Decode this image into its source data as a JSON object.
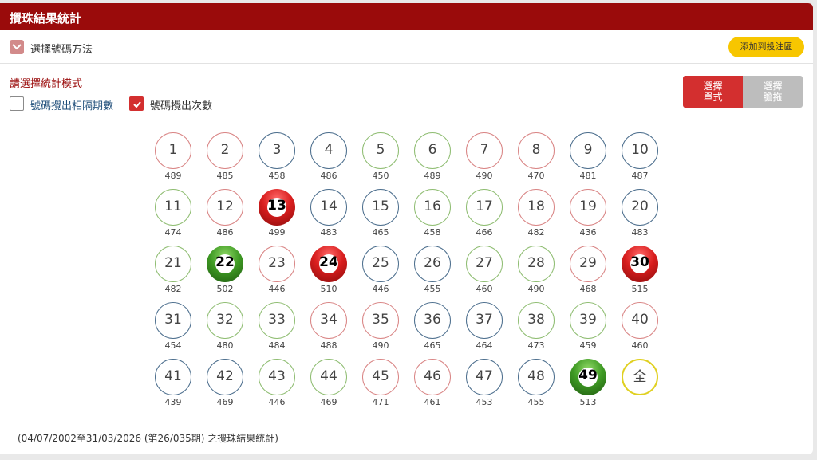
{
  "header": {
    "title": "攪珠結果統計"
  },
  "method": {
    "label": "選擇號碼方法",
    "add_button": "添加到投注區"
  },
  "mode": {
    "title": "請選擇統計模式",
    "option_interval": "號碼攪出相隔期數",
    "option_count": "號碼攪出次數",
    "option_interval_checked": false,
    "option_count_checked": true
  },
  "select": {
    "single_line1": "選擇",
    "single_line2": "單式",
    "banker_line1": "選擇",
    "banker_line2": "膽拖"
  },
  "balls": [
    {
      "n": "1",
      "c": "489",
      "color": "red"
    },
    {
      "n": "2",
      "c": "485",
      "color": "red"
    },
    {
      "n": "3",
      "c": "458",
      "color": "blue"
    },
    {
      "n": "4",
      "c": "486",
      "color": "blue"
    },
    {
      "n": "5",
      "c": "450",
      "color": "green"
    },
    {
      "n": "6",
      "c": "489",
      "color": "green"
    },
    {
      "n": "7",
      "c": "490",
      "color": "red"
    },
    {
      "n": "8",
      "c": "470",
      "color": "red"
    },
    {
      "n": "9",
      "c": "481",
      "color": "blue"
    },
    {
      "n": "10",
      "c": "487",
      "color": "blue"
    },
    {
      "n": "11",
      "c": "474",
      "color": "green"
    },
    {
      "n": "12",
      "c": "486",
      "color": "red"
    },
    {
      "n": "13",
      "c": "499",
      "color": "red",
      "hot": true
    },
    {
      "n": "14",
      "c": "483",
      "color": "blue"
    },
    {
      "n": "15",
      "c": "465",
      "color": "blue"
    },
    {
      "n": "16",
      "c": "458",
      "color": "green"
    },
    {
      "n": "17",
      "c": "466",
      "color": "green"
    },
    {
      "n": "18",
      "c": "482",
      "color": "red"
    },
    {
      "n": "19",
      "c": "436",
      "color": "red"
    },
    {
      "n": "20",
      "c": "483",
      "color": "blue"
    },
    {
      "n": "21",
      "c": "482",
      "color": "green"
    },
    {
      "n": "22",
      "c": "502",
      "color": "green",
      "hot": true
    },
    {
      "n": "23",
      "c": "446",
      "color": "red"
    },
    {
      "n": "24",
      "c": "510",
      "color": "red",
      "hot": true
    },
    {
      "n": "25",
      "c": "446",
      "color": "blue"
    },
    {
      "n": "26",
      "c": "455",
      "color": "blue"
    },
    {
      "n": "27",
      "c": "460",
      "color": "green"
    },
    {
      "n": "28",
      "c": "490",
      "color": "green"
    },
    {
      "n": "29",
      "c": "468",
      "color": "red"
    },
    {
      "n": "30",
      "c": "515",
      "color": "red",
      "hot": true
    },
    {
      "n": "31",
      "c": "454",
      "color": "blue"
    },
    {
      "n": "32",
      "c": "480",
      "color": "green"
    },
    {
      "n": "33",
      "c": "484",
      "color": "green"
    },
    {
      "n": "34",
      "c": "488",
      "color": "red"
    },
    {
      "n": "35",
      "c": "490",
      "color": "red"
    },
    {
      "n": "36",
      "c": "465",
      "color": "blue"
    },
    {
      "n": "37",
      "c": "464",
      "color": "blue"
    },
    {
      "n": "38",
      "c": "473",
      "color": "green"
    },
    {
      "n": "39",
      "c": "459",
      "color": "green"
    },
    {
      "n": "40",
      "c": "460",
      "color": "red"
    },
    {
      "n": "41",
      "c": "439",
      "color": "blue"
    },
    {
      "n": "42",
      "c": "469",
      "color": "blue"
    },
    {
      "n": "43",
      "c": "446",
      "color": "green"
    },
    {
      "n": "44",
      "c": "469",
      "color": "green"
    },
    {
      "n": "45",
      "c": "471",
      "color": "red"
    },
    {
      "n": "46",
      "c": "461",
      "color": "red"
    },
    {
      "n": "47",
      "c": "453",
      "color": "blue"
    },
    {
      "n": "48",
      "c": "455",
      "color": "blue"
    },
    {
      "n": "49",
      "c": "513",
      "color": "green",
      "hot": true
    },
    {
      "n": "全",
      "c": "",
      "color": "all"
    }
  ],
  "footer": {
    "text": "(04/07/2002至31/03/2026 (第26/035期) 之攪珠結果統計)"
  },
  "colors": {
    "header": "#9a0b0b",
    "accent_red": "#d32f2f",
    "add_button": "#f7c600",
    "inactive": "#bdbdbd"
  }
}
